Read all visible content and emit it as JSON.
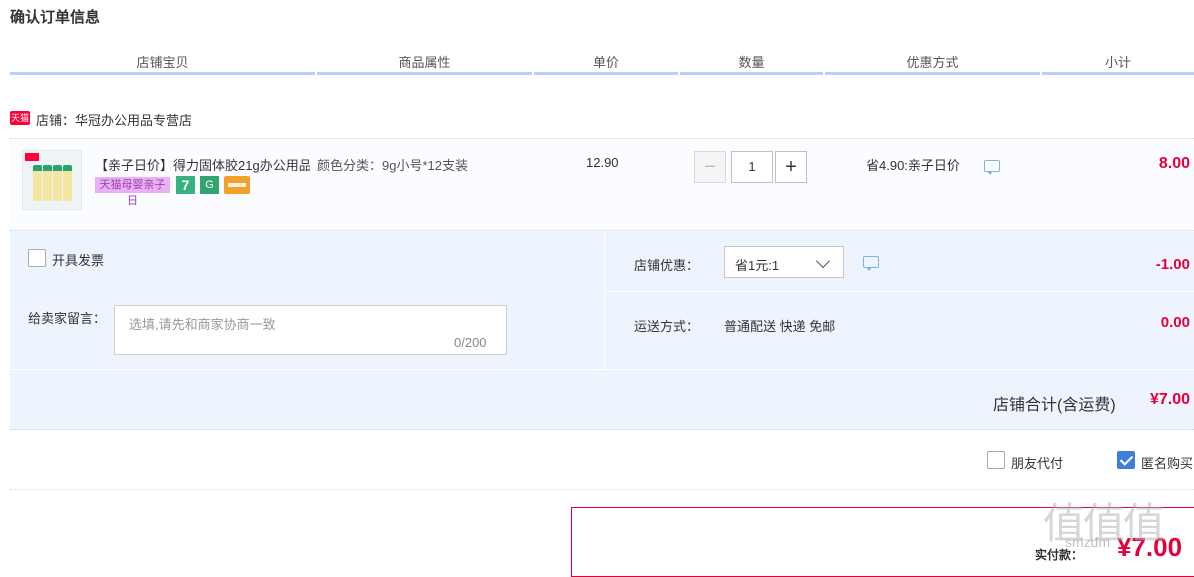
{
  "page": {
    "title": "确认订单信息"
  },
  "columns": [
    "店铺宝贝",
    "商品属性",
    "单价",
    "数量",
    "优惠方式",
    "小计"
  ],
  "shop": {
    "badge": "天猫",
    "name": "店铺：华冠办公用品专营店"
  },
  "item": {
    "title": "【亲子日价】得力固体胶21g办公用品",
    "promo_badge": "天猫母婴亲子日",
    "badge_seven": "7",
    "badge_g": "G",
    "attribute": "颜色分类：9g小号*12支装",
    "price": "12.90",
    "quantity": "1",
    "minus": "−",
    "plus": "+",
    "discount": "省4.90:亲子日价",
    "subtotal": "8.00"
  },
  "invoice": {
    "label": "开具发票",
    "checked": false
  },
  "message": {
    "label": "给卖家留言：",
    "placeholder": "选填,请先和商家协商一致",
    "count": "0/200"
  },
  "shop_discount": {
    "label": "店铺优惠：",
    "selected": "省1元:1",
    "amount": "-1.00"
  },
  "shipping": {
    "label": "运送方式：",
    "value": "普通配送 快递 免邮",
    "amount": "0.00"
  },
  "shop_total": {
    "label": "店铺合计(含运费)",
    "value": "¥7.00"
  },
  "friend_pay": {
    "label": "朋友代付",
    "checked": false
  },
  "anonymous": {
    "label": "匿名购买",
    "checked": true
  },
  "payment": {
    "label": "实付款：",
    "value": "¥7.00"
  },
  "watermark": {
    "text": "值值值",
    "sub": "smzdm"
  },
  "colors": {
    "price_red": "#e4003a",
    "accent_blue": "#3d7fdb",
    "header_line": "#b7d1f2"
  }
}
